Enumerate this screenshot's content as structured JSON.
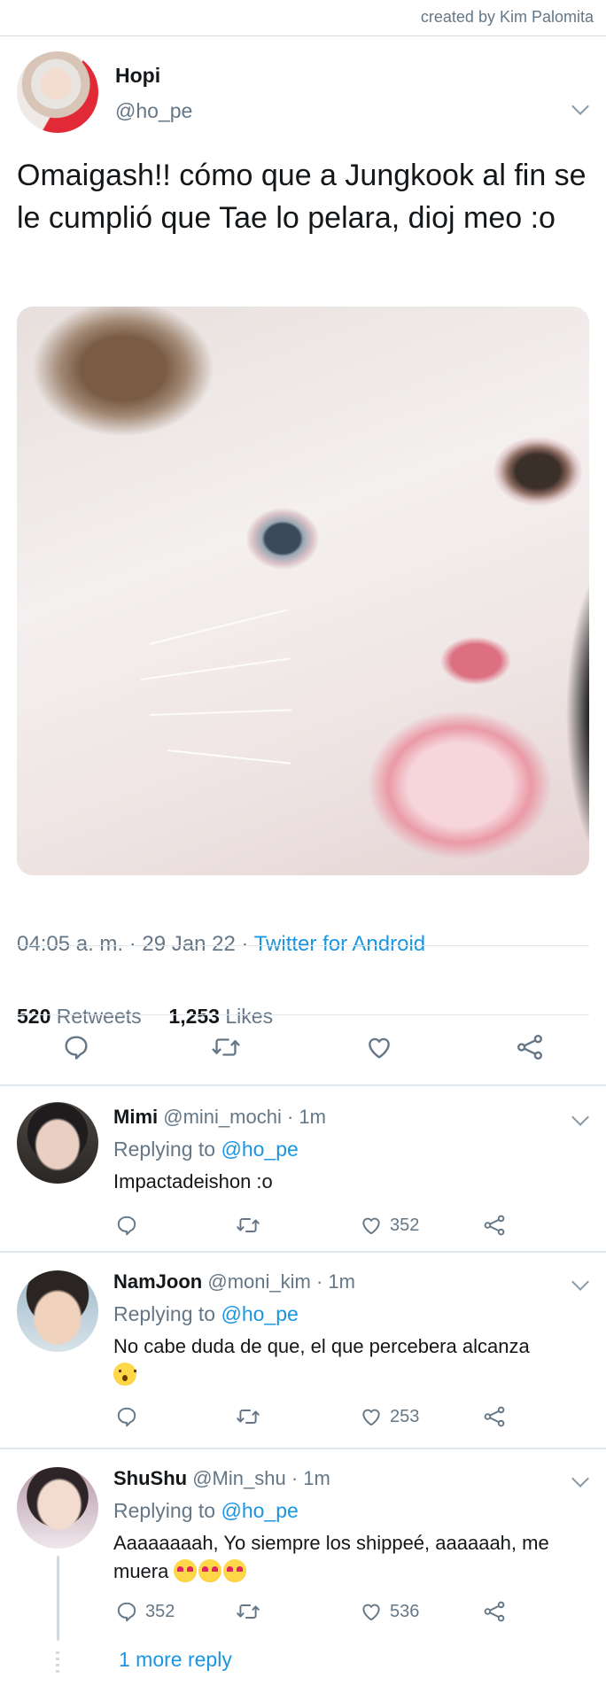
{
  "credit": "created by Kim Palomita",
  "tweet": {
    "name": "Hopi",
    "handle": "@ho_pe",
    "text": "Omaigash!! cómo que a Jungkook al fin se le cumplió que Tae lo pelara, dioj meo :o",
    "time": "04:05 a. m. · 29 Jan 22 · ",
    "source": "Twitter for Android",
    "retweets": "520",
    "retweets_label": " Retweets",
    "likes": "1,253",
    "likes_label": " Likes"
  },
  "icons": [
    "reply-icon",
    "retweet-icon",
    "like-icon",
    "share-icon",
    "chevron-down-icon"
  ],
  "colors": {
    "link": "#1b95e0",
    "muted": "#657786",
    "text": "#14171a",
    "divider": "#e1e8ed"
  },
  "replies": [
    {
      "name": "Mimi",
      "meta": " @mini_mochi · 1m",
      "replying_prefix": "Replying to ",
      "replying_to": "@ho_pe",
      "text": "Impactadeishon :o",
      "reply_count": "",
      "like_count": "352"
    },
    {
      "name": "NamJoon",
      "meta": " @moni_kim · 1m",
      "replying_prefix": "Replying to ",
      "replying_to": "@ho_pe",
      "text": "No cabe duda de que, el que percebera alcanza",
      "reply_count": "",
      "like_count": "253"
    },
    {
      "name": "ShuShu",
      "meta": " @Min_shu · 1m",
      "replying_prefix": "Replying to ",
      "replying_to": "@ho_pe",
      "text": "Aaaaaaaah, Yo siempre los shippeé, aaaaaah, me muera",
      "reply_count": "352",
      "like_count": "536"
    }
  ],
  "more_replies": "1 more reply"
}
